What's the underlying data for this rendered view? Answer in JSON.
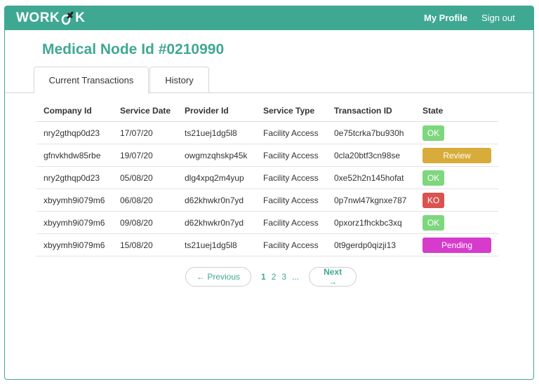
{
  "app": {
    "logo_left": "WORK",
    "logo_right": "K"
  },
  "nav": {
    "profile": "My Profile",
    "signout": "Sign out"
  },
  "page_title": "Medical Node Id #0210990",
  "tabs": [
    {
      "label": "Current Transactions",
      "active": true
    },
    {
      "label": "History",
      "active": false
    }
  ],
  "table": {
    "headers": [
      "Company Id",
      "Service Date",
      "Provider Id",
      "Service Type",
      "Transaction ID",
      "State"
    ],
    "rows": [
      {
        "company": "nry2gthqp0d23",
        "date": "17/07/20",
        "provider": "ts21uej1dg5l8",
        "type": "Facility Access",
        "tx": "0e75tcrka7bu930h",
        "state": "OK"
      },
      {
        "company": "gfnvkhdw85rbe",
        "date": "19/07/20",
        "provider": "owgmzqhskp45k",
        "type": "Facility Access",
        "tx": "0cla20btf3cn98se",
        "state": "Review"
      },
      {
        "company": "nry2gthqp0d23",
        "date": "05/08/20",
        "provider": "dlg4xpq2m4yup",
        "type": "Facility Access",
        "tx": "0xe52h2n145hofat",
        "state": "OK"
      },
      {
        "company": "xbyymh9i079m6",
        "date": "06/08/20",
        "provider": "d62khwkr0n7yd",
        "type": "Facility Access",
        "tx": "0p7nwl47kgnxe787",
        "state": "KO"
      },
      {
        "company": "xbyymh9i079m6",
        "date": "09/08/20",
        "provider": "d62khwkr0n7yd",
        "type": "Facility Access",
        "tx": "0pxorz1fhckbc3xq",
        "state": "OK"
      },
      {
        "company": "xbyymh9i079m6",
        "date": "15/08/20",
        "provider": "ts21uej1dg5l8",
        "type": "Facility Access",
        "tx": "0t9gerdp0qizji13",
        "state": "Pending"
      }
    ]
  },
  "state_colors": {
    "OK": "#7ed77e",
    "Review": "#d8ac3a",
    "KO": "#d9534f",
    "Pending": "#d63bcb"
  },
  "pagination": {
    "previous": "← Previous",
    "next": "Next →",
    "pages": [
      "1",
      "2",
      "3"
    ],
    "current": "1",
    "ellipsis": "..."
  },
  "colors": {
    "brand": "#3fa893"
  }
}
